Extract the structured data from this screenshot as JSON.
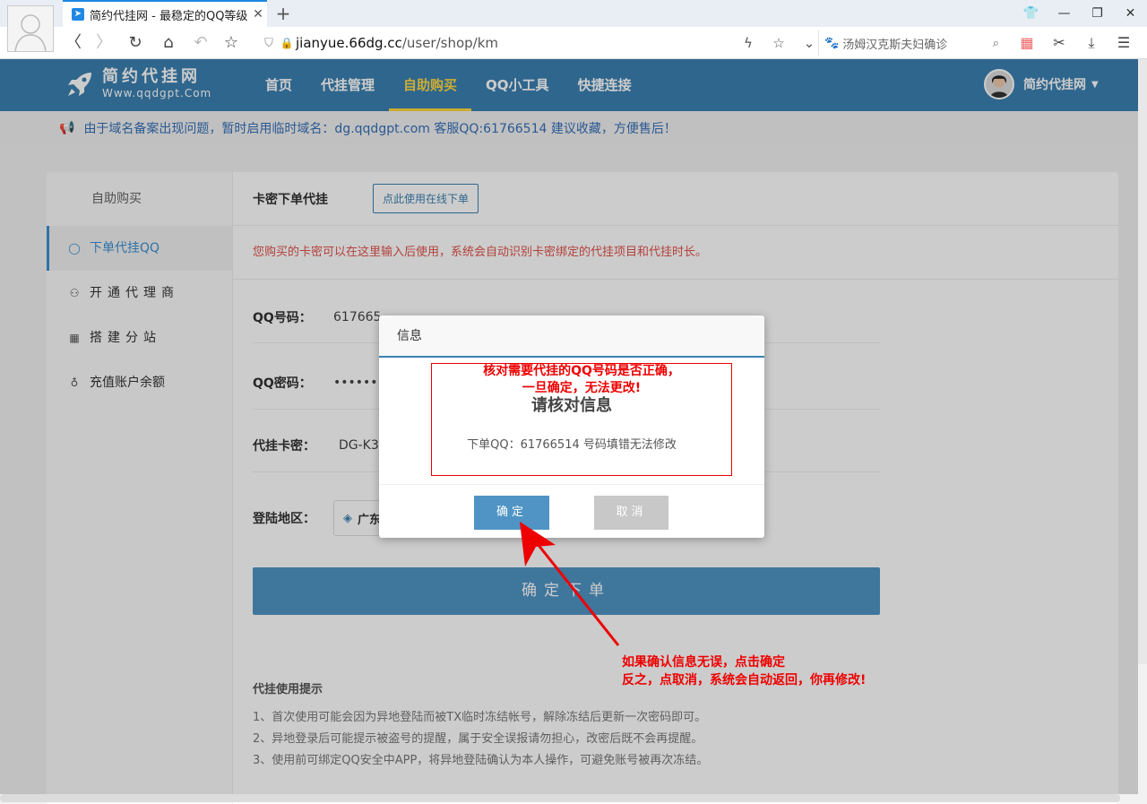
{
  "browser": {
    "tab_title": "简约代挂网 - 最稳定的QQ等级",
    "tab_close": "✕",
    "new_tab": "+",
    "url_host": "jianyue.66dg.cc",
    "url_path": "/user/shop/km",
    "search_text": "汤姆汉克斯夫妇确诊"
  },
  "site": {
    "logo_name": "简约代挂网",
    "logo_domain": "Www.qqdgpt.Com",
    "nav": [
      "首页",
      "代挂管理",
      "自助购买",
      "QQ小工具",
      "快捷连接"
    ],
    "username": "简约代挂网",
    "notice": "由于域名备案出现问题，暂时启用临时域名：dg.qqdgpt.com 客服QQ:61766514 建议收藏，方便售后！"
  },
  "sidebar": {
    "title": "自助购买",
    "items": [
      "下单代挂QQ",
      "开通代理商",
      "搭建分站",
      "充值账户余额"
    ]
  },
  "form": {
    "title": "卡密下单代挂",
    "online_btn": "点此使用在线下单",
    "tip": "您购买的卡密可以在这里输入后使用，系统会自动识别卡密绑定的代挂项目和代挂时长。",
    "qq_label": "QQ号码：",
    "qq_value": "617665",
    "pwd_label": "QQ密码：",
    "pwd_value": "••••••••",
    "card_label": "代挂卡密：",
    "card_value": "DG-K3",
    "region_label": "登陆地区：",
    "region_value": "广东",
    "submit": "确定下单"
  },
  "help": {
    "title": "代挂使用提示",
    "lines": [
      "1、首次使用可能会因为异地登陆而被TX临时冻结帐号，解除冻结后更新一次密码即可。",
      "2、异地登录后可能提示被盗号的提醒，属于安全误报请勿担心，改密后既不会再提醒。",
      "3、使用前可绑定QQ安全中APP，将异地登陆确认为本人操作，可避免账号被再次冻结。"
    ]
  },
  "dialog": {
    "title": "信息",
    "heading": "请核对信息",
    "message": "下单QQ：61766514 号码填错无法修改",
    "ok": "确定",
    "cancel": "取消"
  },
  "annotations": {
    "top_line1": "核对需要代挂的QQ号码是否正确，",
    "top_line2": "一旦确定，无法更改!",
    "bottom_line1": "如果确认信息无误，点击确定",
    "bottom_line2": "反之，点取消，系统会自动返回，你再修改!"
  },
  "colors": {
    "header": "#3b80b1",
    "accent": "#ffd740",
    "annotation": "#e00000"
  }
}
